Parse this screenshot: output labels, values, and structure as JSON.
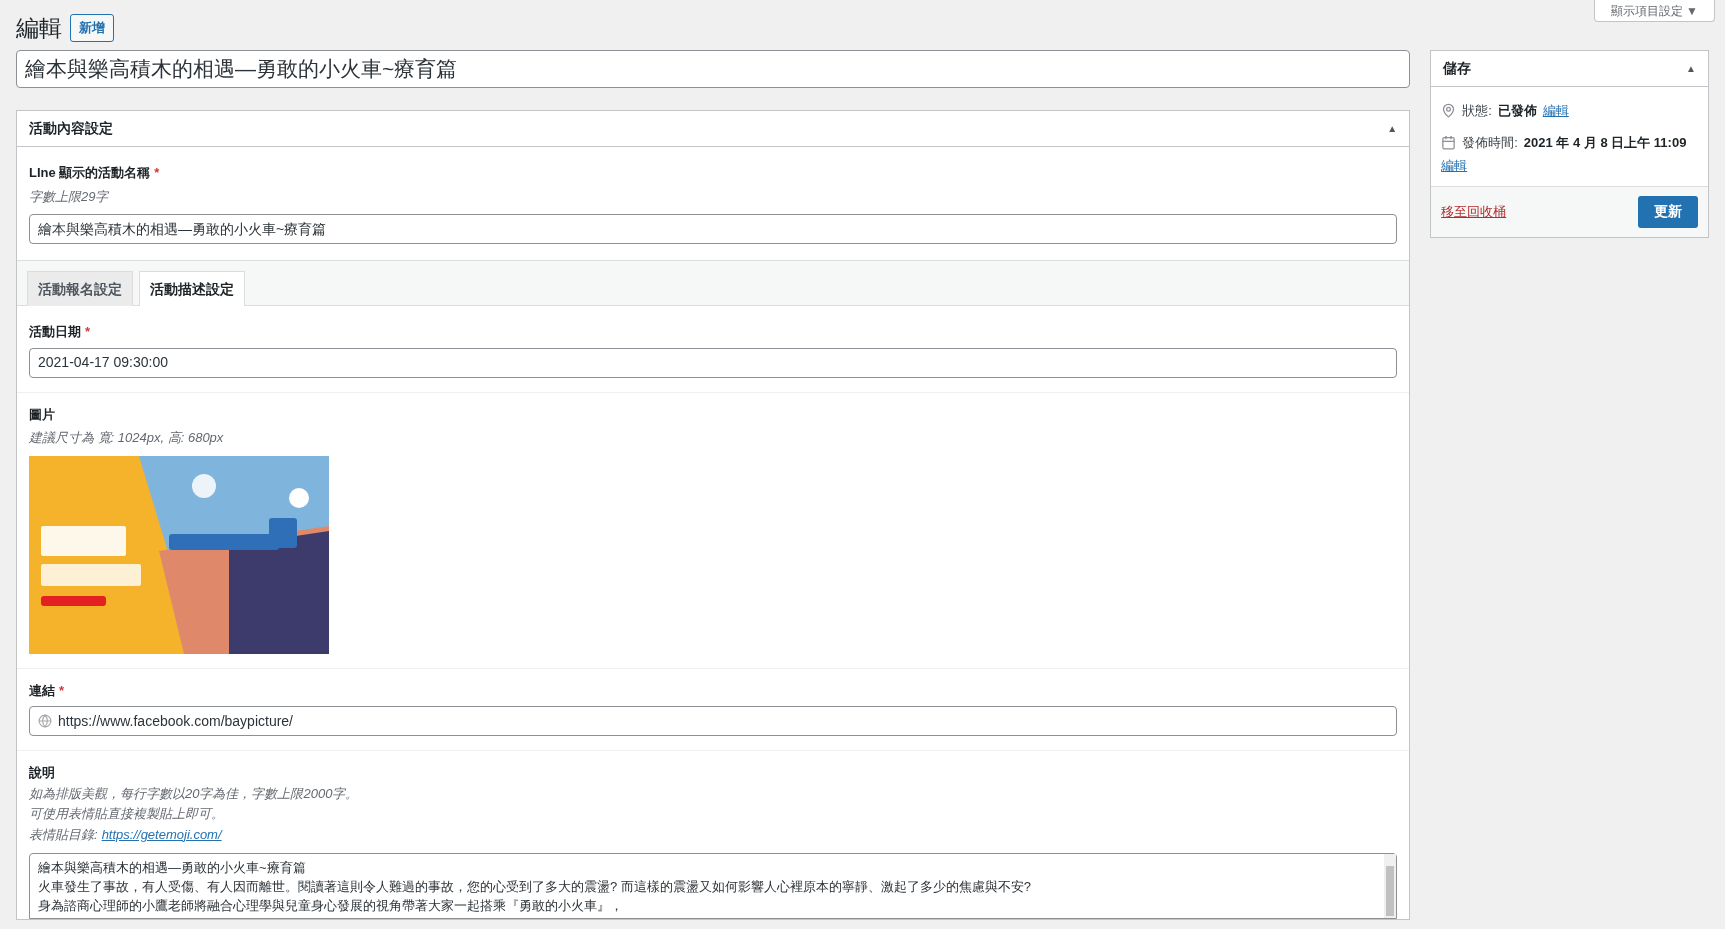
{
  "header": {
    "title": "編輯",
    "add_button": "新增",
    "screen_options": "顯示項目設定 ▼"
  },
  "post_title": {
    "value": "繪本與樂高積木的相遇—勇敢的小火車~療育篇"
  },
  "content_box": {
    "title": "活動內容設定",
    "expanded": true,
    "toggle": "▲",
    "line_name": {
      "label": "LIne 顯示的活動名稱",
      "required": "*",
      "hint": "字數上限29字",
      "value": "繪本與樂高積木的相遇—勇敢的小火車~療育篇"
    },
    "tabs": [
      {
        "label": "活動報名設定",
        "selected": false
      },
      {
        "label": "活動描述設定",
        "selected": true
      }
    ],
    "date": {
      "label": "活動日期",
      "required": "*",
      "value": "2021-04-17 09:30:00"
    },
    "image": {
      "label": "圖片",
      "hint": "建議尺寸為 寬: 1024px, 高: 680px",
      "kind": "picture"
    },
    "link": {
      "label": "連結",
      "required": "*",
      "value": "https://www.facebook.com/baypicture/"
    },
    "description": {
      "label": "說明",
      "hints": [
        "如為排版美觀，每行字數以20字為佳，字數上限2000字。",
        "可使用表情貼直接複製貼上即可。"
      ],
      "emoji_hint": "表情貼目錄:",
      "emoji_link": "https://getemoji.com/",
      "lines": [
        "繪本與樂高積木的相遇—勇敢的小火車~療育篇",
        "火車發生了事故，有人受傷、有人因而離世。閱讀著這則令人難過的事故，您的心受到了多大的震盪? 而這樣的震盪又如何影響人心裡原本的寧靜、激起了多少的焦慮與不安?",
        "身為諮商心理師的小鷹老師將融合心理學與兒童身心發展的視角帶著大家一起搭乘『勇敢的小火車』，"
      ]
    }
  },
  "publish_box": {
    "title": "儲存",
    "expanded": true,
    "toggle": "▲",
    "status_label": "狀態:",
    "status_value": "已發佈",
    "status_edit": "編輯",
    "time_label": "發佈時間:",
    "time_value": "2021 年 4 月 8 日上午 11:09",
    "time_edit": "編輯",
    "trash": "移至回收桶",
    "update": "更新"
  }
}
